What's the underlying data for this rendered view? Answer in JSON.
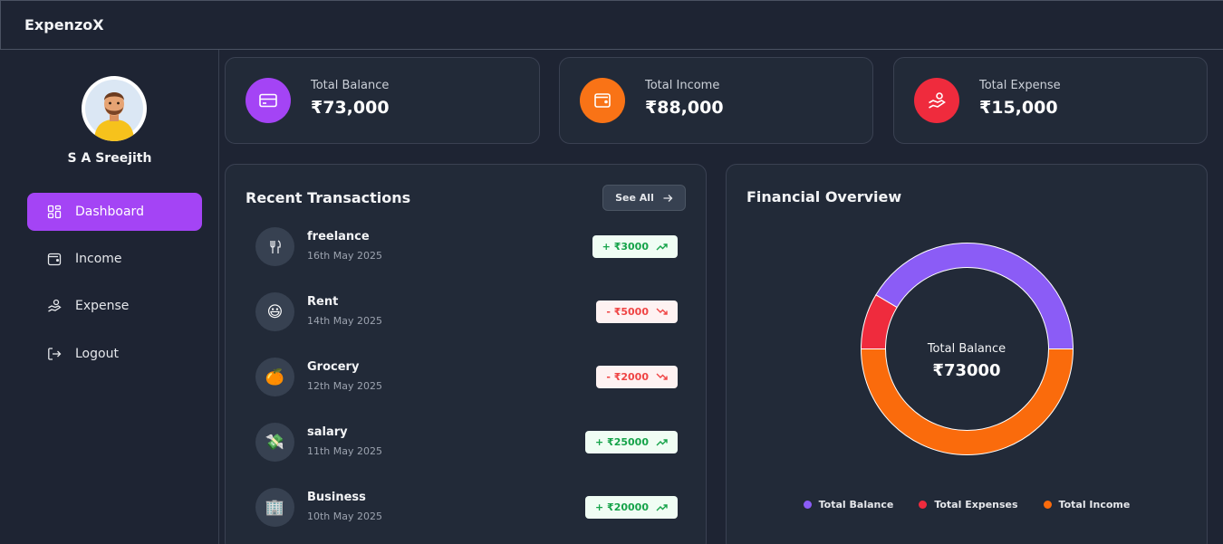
{
  "app": {
    "title": "ExpenzoX"
  },
  "user": {
    "name": "S A Sreejith"
  },
  "sidebar": {
    "items": [
      {
        "label": "Dashboard",
        "icon": "dashboard-icon",
        "active": true
      },
      {
        "label": "Income",
        "icon": "wallet-icon",
        "active": false
      },
      {
        "label": "Expense",
        "icon": "hand-coins-icon",
        "active": false
      },
      {
        "label": "Logout",
        "icon": "logout-icon",
        "active": false
      }
    ]
  },
  "stats": [
    {
      "label": "Total Balance",
      "value": "₹73,000",
      "icon": "credit-card-icon",
      "color": "#a444f5"
    },
    {
      "label": "Total Income",
      "value": "₹88,000",
      "icon": "wallet-icon",
      "color": "#f97316"
    },
    {
      "label": "Total Expense",
      "value": "₹15,000",
      "icon": "hand-coins-icon",
      "color": "#ef2b3d"
    }
  ],
  "transactions": {
    "title": "Recent Transactions",
    "see_all": "See All",
    "items": [
      {
        "name": "freelance",
        "date": "16th May 2025",
        "amount": "+ ₹3000",
        "type": "income",
        "icon": "utensils-icon"
      },
      {
        "name": "Rent",
        "date": "14th May 2025",
        "amount": "- ₹5000",
        "type": "expense",
        "icon": "grinning-face-emoji",
        "emoji": "😃"
      },
      {
        "name": "Grocery",
        "date": "12th May 2025",
        "amount": "- ₹2000",
        "type": "expense",
        "icon": "tangerine-emoji",
        "emoji": "🍊"
      },
      {
        "name": "salary",
        "date": "11th May 2025",
        "amount": "+ ₹25000",
        "type": "income",
        "icon": "money-wings-emoji",
        "emoji": "💸"
      },
      {
        "name": "Business",
        "date": "10th May 2025",
        "amount": "+ ₹20000",
        "type": "income",
        "icon": "office-building-emoji",
        "emoji": "🏢"
      }
    ]
  },
  "overview": {
    "title": "Financial Overview",
    "center_label": "Total Balance",
    "center_value": "₹73000"
  },
  "chart_data": {
    "type": "pie",
    "categories": [
      "Total Balance",
      "Total Expenses",
      "Total Income"
    ],
    "values": [
      73000,
      15000,
      88000
    ],
    "colors": [
      "#8b5cf6",
      "#ef2b3d",
      "#fa6b0c"
    ],
    "legend": "bottom"
  }
}
